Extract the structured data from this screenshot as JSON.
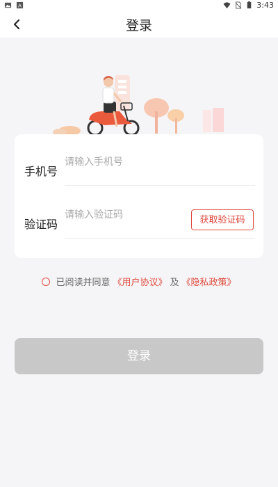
{
  "status_bar": {
    "time": "3:43",
    "icons": [
      "image-icon",
      "notification-icon",
      "wifi-icon",
      "no-sim-icon",
      "battery-icon"
    ]
  },
  "header": {
    "title": "登录"
  },
  "form": {
    "phone_label": "手机号",
    "phone_placeholder": "请输入手机号",
    "phone_value": "",
    "code_label": "验证码",
    "code_placeholder": "请输入验证码",
    "code_value": "",
    "get_code_label": "获取验证码"
  },
  "agreement": {
    "prefix": "已阅读并同意",
    "user_agreement": "《用户协议》",
    "and": "及",
    "privacy_policy": "《隐私政策》",
    "checked": false
  },
  "login_button": {
    "label": "登录",
    "enabled": false
  },
  "colors": {
    "accent": "#e0493c",
    "disabled_button": "#c8c8c8",
    "background": "#f5f5f7"
  }
}
